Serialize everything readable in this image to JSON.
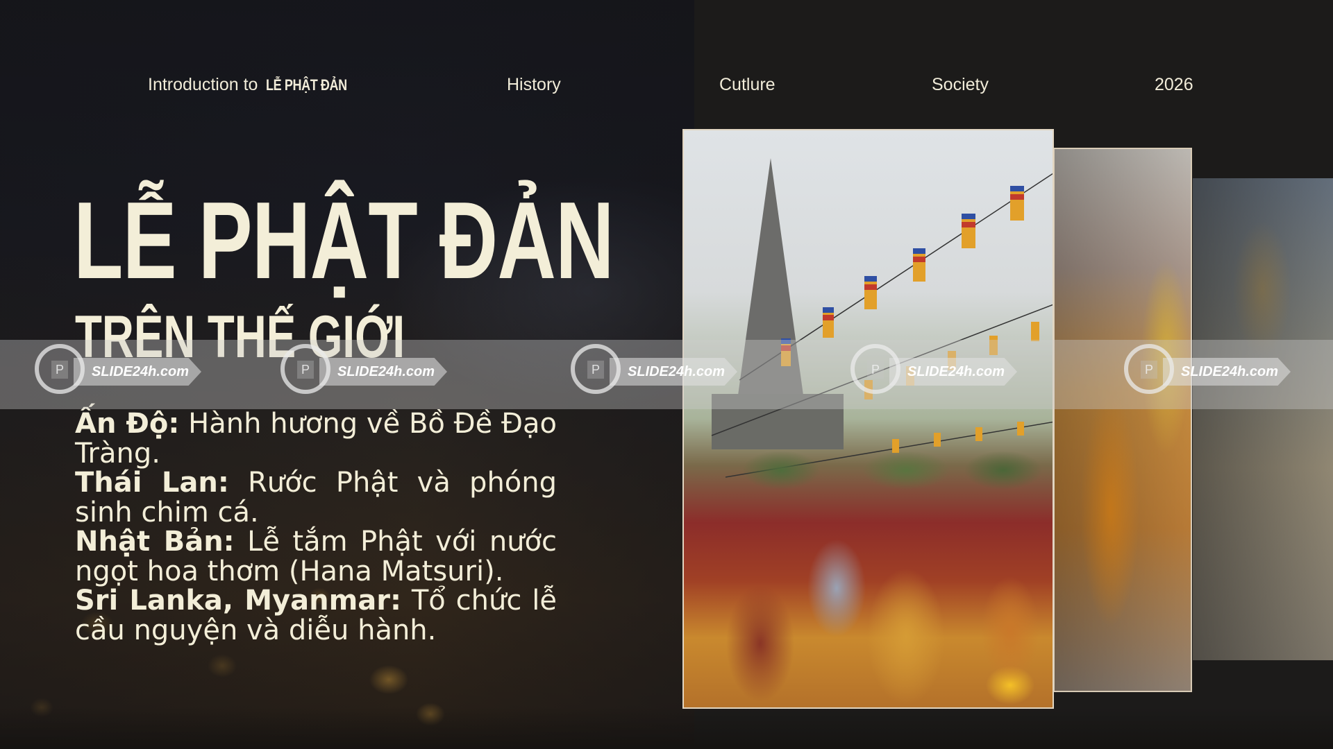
{
  "nav": {
    "intro_prefix": "Introduction to",
    "intro_brand": "LỄ PHẬT ĐẢN",
    "items": [
      "History",
      "Cutlure",
      "Society",
      "2026"
    ]
  },
  "title": {
    "main": "LỄ PHẬT ĐẢN",
    "sub": "TRÊN THẾ GIỚI"
  },
  "body": [
    {
      "label": "Ấn Độ:",
      "text": " Hành hương về Bồ Đề Đạo Tràng."
    },
    {
      "label": "Thái Lan:",
      "text": " Rước Phật và phóng sinh chim cá."
    },
    {
      "label": "Nhật Bản:",
      "text": " Lễ tắm Phật với nước ngọt hoa thơm (Hana Matsuri)."
    },
    {
      "label": "Sri Lanka, Myanmar:",
      "text": " Tổ chức lễ cầu nguyện và diễu hành."
    }
  ],
  "watermark": {
    "text": "SLIDE24h.com"
  },
  "colors": {
    "background": "#1c1b1a",
    "text_cream": "#f3eed8"
  }
}
